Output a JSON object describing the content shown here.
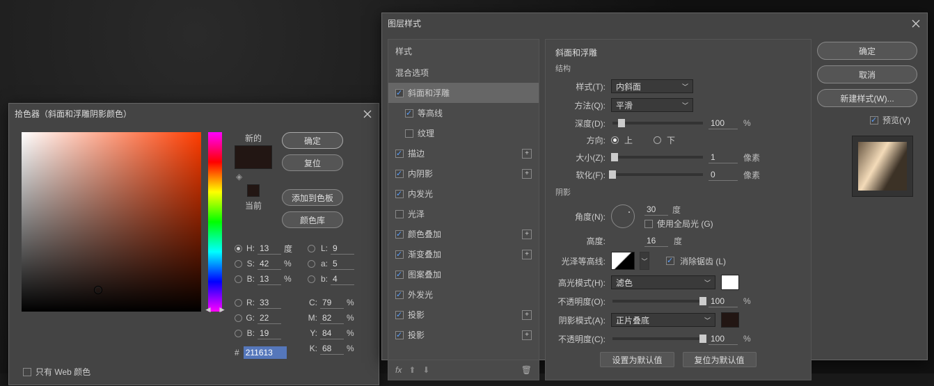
{
  "colorPicker": {
    "title": "拾色器（斜面和浮雕阴影颜色）",
    "new_label": "新的",
    "current_label": "当前",
    "ok": "确定",
    "reset": "复位",
    "add_swatch": "添加到色板",
    "libs": "颜色库",
    "H": {
      "label": "H:",
      "value": "13",
      "unit": "度"
    },
    "S": {
      "label": "S:",
      "value": "42",
      "unit": "%"
    },
    "Bv": {
      "label": "B:",
      "value": "13",
      "unit": "%"
    },
    "L": {
      "label": "L:",
      "value": "9"
    },
    "a": {
      "label": "a:",
      "value": "5"
    },
    "b": {
      "label": "b:",
      "value": "4"
    },
    "R": {
      "label": "R:",
      "value": "33"
    },
    "G": {
      "label": "G:",
      "value": "22"
    },
    "Bc": {
      "label": "B:",
      "value": "19"
    },
    "C": {
      "label": "C:",
      "value": "79",
      "unit": "%"
    },
    "M": {
      "label": "M:",
      "value": "82",
      "unit": "%"
    },
    "Y": {
      "label": "Y:",
      "value": "84",
      "unit": "%"
    },
    "K": {
      "label": "K:",
      "value": "68",
      "unit": "%"
    },
    "hash": "#",
    "hex": "211613",
    "web_only": "只有 Web 颜色"
  },
  "layerStyle": {
    "title": "图层样式",
    "styles_header": "样式",
    "blend_opts": "混合选项",
    "items": {
      "bevel": "斜面和浮雕",
      "contour": "等高线",
      "texture": "纹理",
      "stroke": "描边",
      "inner_shadow": "内阴影",
      "inner_glow": "内发光",
      "satin": "光泽",
      "color_overlay": "颜色叠加",
      "grad_overlay": "渐变叠加",
      "pat_overlay": "图案叠加",
      "outer_glow": "外发光",
      "drop_shadow1": "投影",
      "drop_shadow2": "投影"
    },
    "fx": "fx",
    "section_title": "斜面和浮雕",
    "struct_title": "结构",
    "style_label": "样式(T):",
    "style_value": "内斜面",
    "tech_label": "方法(Q):",
    "tech_value": "平滑",
    "depth_label": "深度(D):",
    "depth_value": "100",
    "depth_unit": "%",
    "dir_label": "方向:",
    "dir_up": "上",
    "dir_down": "下",
    "size_label": "大小(Z):",
    "size_value": "1",
    "size_unit": "像素",
    "soften_label": "软化(F):",
    "soften_value": "0",
    "soften_unit": "像素",
    "shade_title": "阴影",
    "angle_label": "角度(N):",
    "angle_value": "30",
    "angle_unit": "度",
    "global_light": "使用全局光 (G)",
    "alt_label": "高度:",
    "alt_value": "16",
    "alt_unit": "度",
    "gloss_label": "光泽等高线:",
    "antialias": "消除锯齿 (L)",
    "hi_mode_label": "高光模式(H):",
    "hi_mode_value": "滤色",
    "hi_op_label": "不透明度(O):",
    "hi_op_value": "100",
    "pct": "%",
    "sh_mode_label": "阴影模式(A):",
    "sh_mode_value": "正片叠底",
    "sh_op_label": "不透明度(C):",
    "sh_op_value": "100",
    "make_default": "设置为默认值",
    "reset_default": "复位为默认值",
    "ok": "确定",
    "cancel": "取消",
    "new_style": "新建样式(W)...",
    "preview": "预览(V)"
  }
}
